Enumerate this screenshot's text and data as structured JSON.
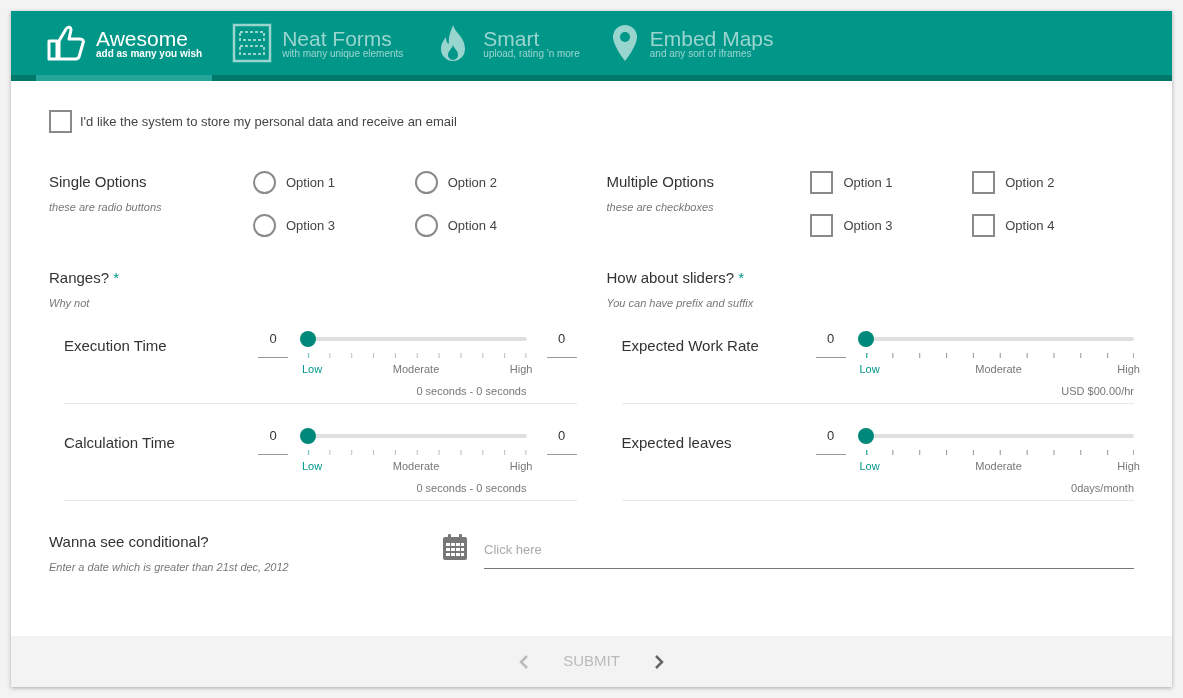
{
  "tabs": [
    {
      "title": "Awesome",
      "subtitle": "add as many you wish",
      "selected": true
    },
    {
      "title": "Neat Forms",
      "subtitle": "with many unique elements",
      "selected": false
    },
    {
      "title": "Smart",
      "subtitle": "upload, rating 'n more",
      "selected": false
    },
    {
      "title": "Embed Maps",
      "subtitle": "and any sort of iframes",
      "selected": false
    }
  ],
  "consent": {
    "label": "I'd like the system to store my personal data and receive an email",
    "checked": false
  },
  "single_options": {
    "title": "Single Options",
    "hint": "these are radio buttons",
    "options": [
      {
        "label": "Option 1",
        "selected": false
      },
      {
        "label": "Option 2",
        "selected": false
      },
      {
        "label": "Option 3",
        "selected": false
      },
      {
        "label": "Option 4",
        "selected": false
      }
    ]
  },
  "multiple_options": {
    "title": "Multiple Options",
    "hint": "these are checkboxes",
    "options": [
      {
        "label": "Option 1",
        "checked": false
      },
      {
        "label": "Option 2",
        "checked": false
      },
      {
        "label": "Option 3",
        "checked": false
      },
      {
        "label": "Option 4",
        "checked": false
      }
    ]
  },
  "ranges": {
    "title": "Ranges?",
    "required_mark": "*",
    "hint": "Why not",
    "rows": [
      {
        "label": "Execution Time",
        "min_value": "0",
        "max_value": "0",
        "level": 0,
        "scale": [
          {
            "label": "Low",
            "selected": true
          },
          {
            "label": "Moderate",
            "selected": false
          },
          {
            "label": "High",
            "selected": false
          }
        ],
        "summary": "0 seconds - 0 seconds"
      },
      {
        "label": "Calculation Time",
        "min_value": "0",
        "max_value": "0",
        "level": 0,
        "scale": [
          {
            "label": "Low",
            "selected": true
          },
          {
            "label": "Moderate",
            "selected": false
          },
          {
            "label": "High",
            "selected": false
          }
        ],
        "summary": "0 seconds - 0 seconds"
      }
    ]
  },
  "sliders": {
    "title": "How about sliders?",
    "required_mark": "*",
    "hint": "You can have prefix and suffix",
    "rows": [
      {
        "label": "Expected Work Rate",
        "value": "0",
        "level": 0,
        "scale": [
          {
            "label": "Low",
            "selected": true
          },
          {
            "label": "Moderate",
            "selected": false
          },
          {
            "label": "High",
            "selected": false
          }
        ],
        "summary": "USD $00.00/hr"
      },
      {
        "label": "Expected leaves",
        "value": "0",
        "level": 0,
        "scale": [
          {
            "label": "Low",
            "selected": true
          },
          {
            "label": "Moderate",
            "selected": false
          },
          {
            "label": "High",
            "selected": false
          }
        ],
        "summary": "0days/month"
      }
    ]
  },
  "conditional": {
    "title": "Wanna see conditional?",
    "hint": "Enter a date which is greater than 21st dec, 2012",
    "placeholder": "Click here"
  },
  "footer": {
    "previous_disabled": true,
    "submit": {
      "label": "SUBMIT",
      "disabled": true
    },
    "next_disabled": false
  }
}
